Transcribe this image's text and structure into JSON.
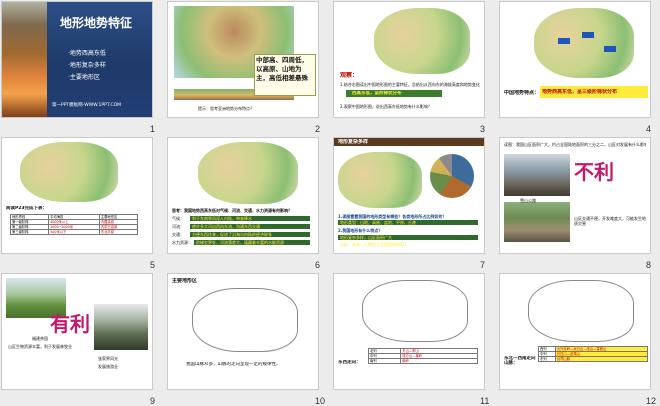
{
  "slides": [
    {
      "number": "1",
      "title": "地形地势特征",
      "bullets": [
        "·地势西高东低",
        "·地形复杂多样",
        "·主要地形区"
      ],
      "footer": "第一PPT模板网-WWW.1PPT.COM"
    },
    {
      "number": "2",
      "callout": "中部高、四周低，以高原、山地为主，高低相差悬殊",
      "caption": "提示：思考亚洲地势分布特点？"
    },
    {
      "number": "3",
      "label": "观察：",
      "q1": "1.结合右图读出中国地形图的主要特征，总结出从西向东的海拔高度和地势变化",
      "answer": "西高东低，呈阶梯状分布",
      "q2": "2.观察中国地形图，说出西高东低地势有什么影响？"
    },
    {
      "number": "4",
      "label": "中国地势特点：",
      "answer": "地势西高东低，呈三级阶梯状分布"
    },
    {
      "number": "5",
      "prompt": "阅读P23完成下表：",
      "headers": [
        "地形界线",
        "平均海拔",
        "主要地形区"
      ],
      "rows": [
        [
          "第一级阶梯",
          "4000米以上",
          "青藏高原"
        ],
        [
          "第二级阶梯",
          "1000~2000米",
          "内蒙古高原"
        ],
        [
          "第三级阶梯",
          "500米以下",
          "东北平原"
        ]
      ]
    },
    {
      "number": "6",
      "question": "思考：我国地势西高东低对气候、河流、交通、水力资源有何影响？",
      "rows": [
        {
          "k": "气候：",
          "v": "利于东南季风深入内陆，带来降水"
        },
        {
          "k": "河流：",
          "v": "使许多大河自西向东流，沟通东西交通"
        },
        {
          "k": "交通：",
          "v": "方便东西往来，促进了沿海与内陆的经济联系"
        },
        {
          "k": "水力资源：",
          "v": "阶梯交界处，河流落差大，蕴藏着丰富的水能资源"
        }
      ]
    },
    {
      "number": "7",
      "title": "地形复杂多样",
      "q1": "1.读图看看我国的地形类型有哪些？各类地形所占比例如何？",
      "a1": "地形类型：山地、高原、盆地、平原、丘陵",
      "q2": "2.我国地形有什么特点？",
      "a2": "地形复杂多样，山区面积广大",
      "note": "山地、高原、丘陵约占全国面积的2/3"
    },
    {
      "number": "8",
      "text1": "读图：我国山区面积广大，约占全国陆地面积的三分之二，山区对发展有什么影响？",
      "overlay": "不利",
      "caption": "雪山公路",
      "text2": "山区交通不便，开发难度大，可能发生地质灾害"
    },
    {
      "number": "9",
      "overlay": "有利",
      "caption1": "福建茶园",
      "text1": "山区生物资源丰富，利于发展林牧业",
      "caption2": "张家界风光",
      "text2": "发展旅游业"
    },
    {
      "number": "10",
      "title": "主要地形区",
      "caption": "我国山脉众多，山脉的走向呈现一定的规律性。"
    },
    {
      "number": "11",
      "label": "东西走向：",
      "rows": [
        [
          "北列",
          "天山—阴山"
        ],
        [
          "中列",
          "昆仑山—秦岭"
        ],
        [
          "南列",
          "南岭"
        ]
      ]
    },
    {
      "number": "12",
      "label": "东北—西南走向山脉：",
      "rows": [
        [
          "西列",
          "大兴安岭—太行山—巫山—雪峰山"
        ],
        [
          "中列",
          "长白山—武夷山"
        ],
        [
          "东列",
          "台湾山脉"
        ]
      ]
    }
  ]
}
